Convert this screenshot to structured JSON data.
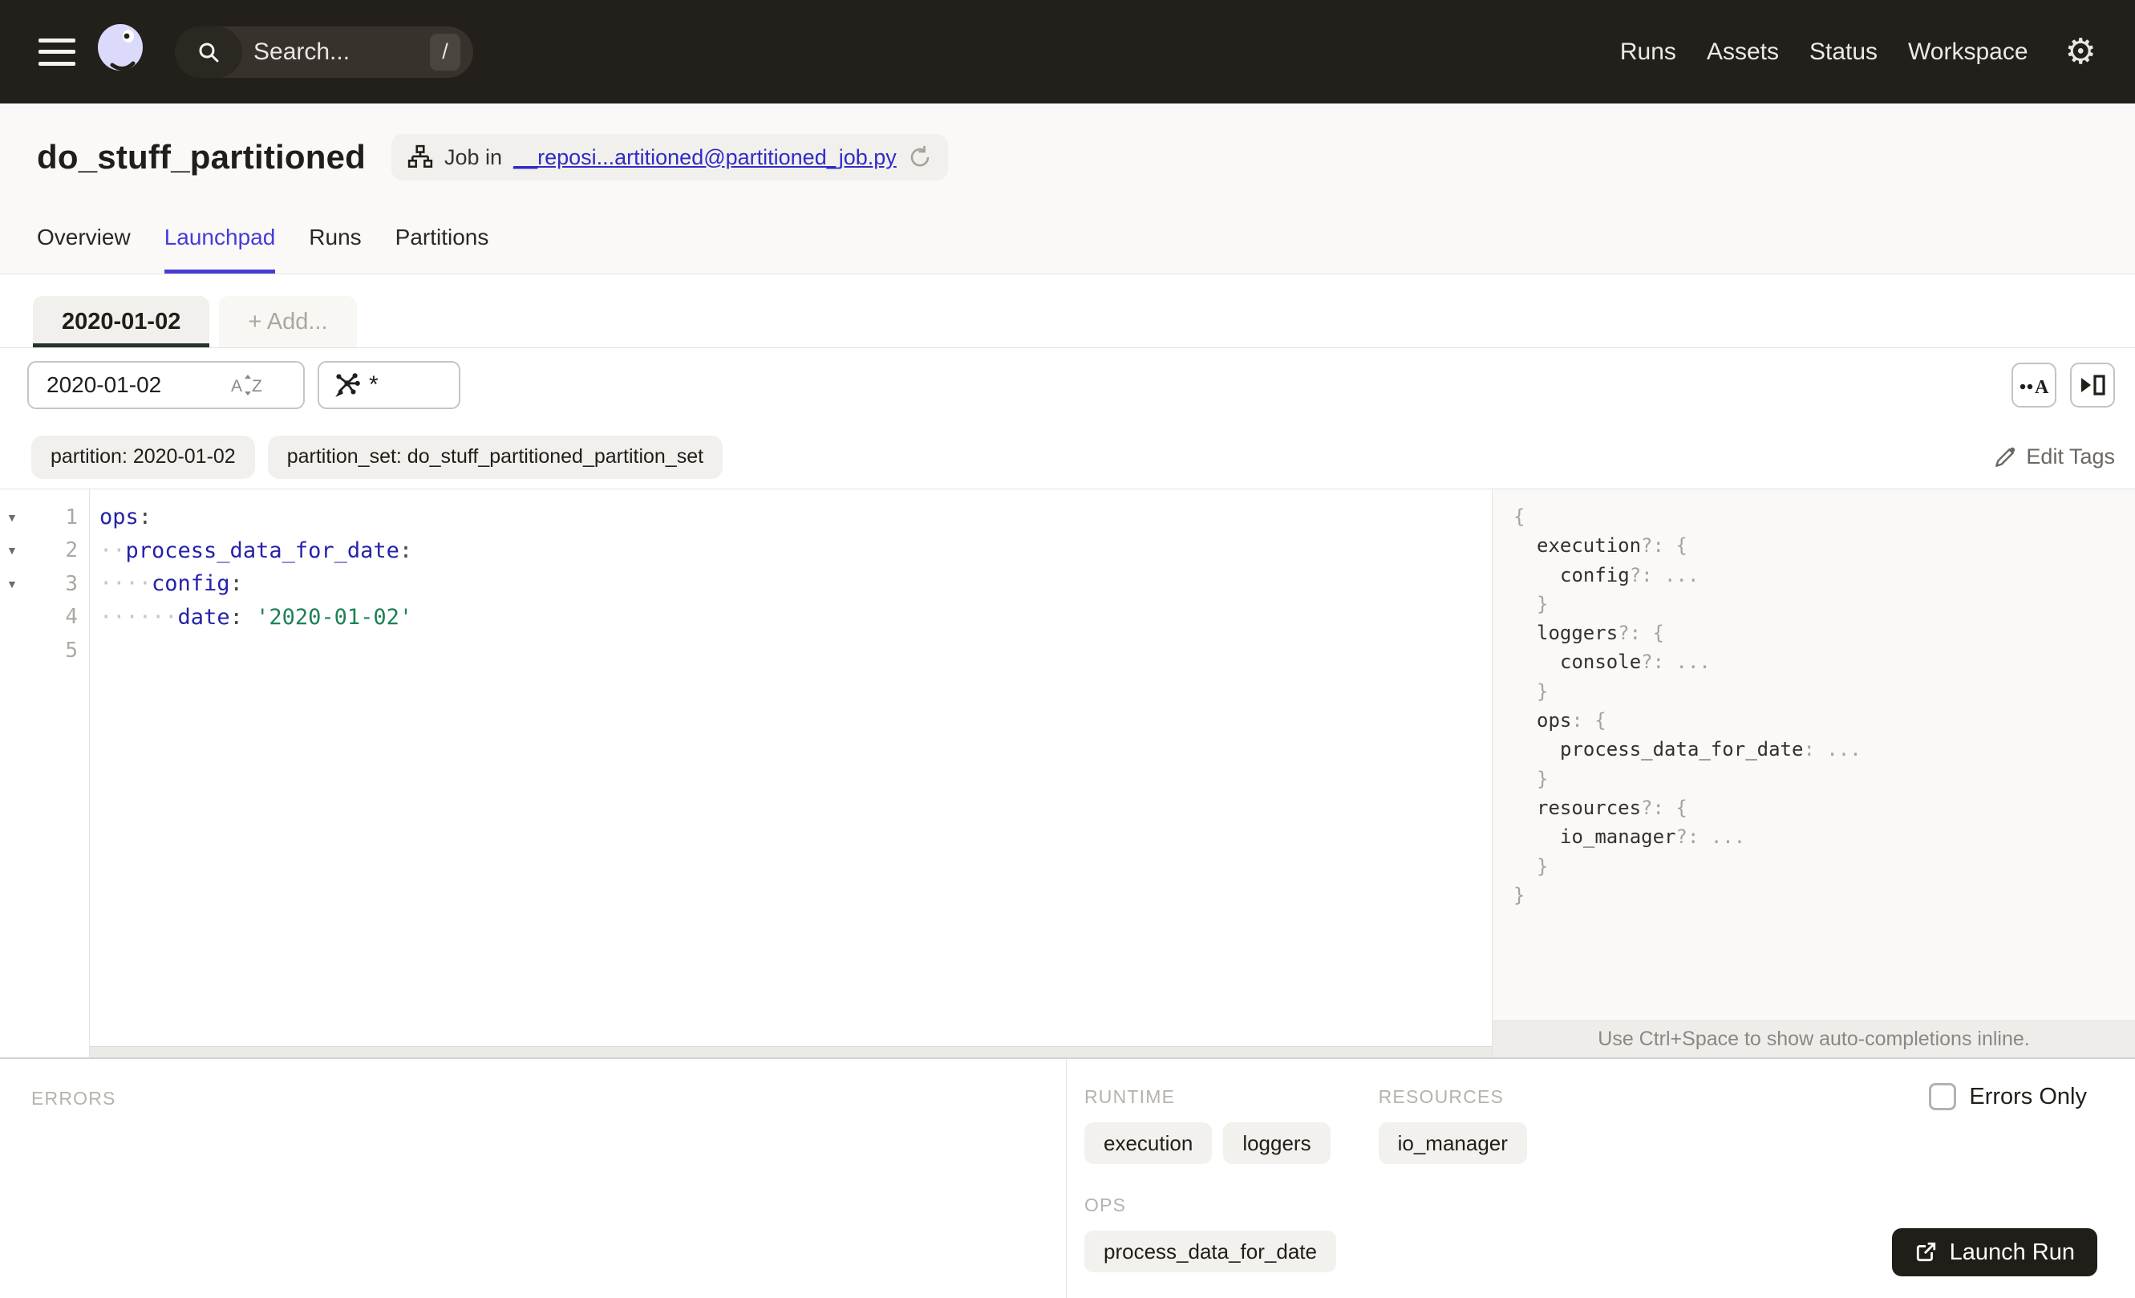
{
  "colors": {
    "nav_bg": "#231f1a",
    "accent_blue": "#453cd8",
    "link_blue": "#2f2bc7",
    "partition_tab_underline": "#213529",
    "yaml_key": "#2522a8",
    "yaml_string": "#1e8155",
    "launch_button_bg": "#211e1a"
  },
  "nav": {
    "search_placeholder": "Search...",
    "search_shortcut": "/",
    "links": [
      "Runs",
      "Assets",
      "Status",
      "Workspace"
    ]
  },
  "header": {
    "title": "do_stuff_partitioned",
    "badge": {
      "prefix": "Job in",
      "link": "__reposi...artitioned@partitioned_job.py"
    },
    "tabs": [
      {
        "label": "Overview",
        "active": false
      },
      {
        "label": "Launchpad",
        "active": true
      },
      {
        "label": "Runs",
        "active": false
      },
      {
        "label": "Partitions",
        "active": false
      }
    ]
  },
  "launchpad": {
    "partition_tab": "2020-01-02",
    "add_tab_label": "+ Add...",
    "partition_input_value": "2020-01-02",
    "op_selection_value": "*"
  },
  "tags": {
    "pills": [
      "partition: 2020-01-02",
      "partition_set: do_stuff_partitioned_partition_set"
    ],
    "edit_label": "Edit Tags"
  },
  "editor": {
    "lines": [
      {
        "num": 1,
        "fold": true,
        "segments": [
          {
            "type": "key",
            "text": "ops"
          },
          {
            "type": "punct",
            "text": ":"
          }
        ]
      },
      {
        "num": 2,
        "fold": true,
        "segments": [
          {
            "type": "ws",
            "text": "··"
          },
          {
            "type": "key",
            "text": "process_data_for_date"
          },
          {
            "type": "punct",
            "text": ":"
          }
        ]
      },
      {
        "num": 3,
        "fold": true,
        "segments": [
          {
            "type": "ws",
            "text": "····"
          },
          {
            "type": "key",
            "text": "config"
          },
          {
            "type": "punct",
            "text": ":"
          }
        ]
      },
      {
        "num": 4,
        "fold": false,
        "segments": [
          {
            "type": "ws",
            "text": "······"
          },
          {
            "type": "key",
            "text": "date"
          },
          {
            "type": "punct",
            "text": ":"
          },
          {
            "type": "plain",
            "text": " "
          },
          {
            "type": "string",
            "text": "'2020-01-02'"
          }
        ]
      },
      {
        "num": 5,
        "fold": false,
        "segments": []
      }
    ]
  },
  "schema": {
    "lines": [
      {
        "indent": 0,
        "segments": [
          {
            "type": "punct",
            "text": "{"
          }
        ]
      },
      {
        "indent": 1,
        "segments": [
          {
            "type": "key",
            "text": "execution"
          },
          {
            "type": "punct",
            "text": "?: {"
          }
        ]
      },
      {
        "indent": 2,
        "segments": [
          {
            "type": "key",
            "text": "config"
          },
          {
            "type": "punct",
            "text": "?: ..."
          }
        ]
      },
      {
        "indent": 1,
        "segments": [
          {
            "type": "punct",
            "text": "}"
          }
        ]
      },
      {
        "indent": 1,
        "segments": [
          {
            "type": "key",
            "text": "loggers"
          },
          {
            "type": "punct",
            "text": "?: {"
          }
        ]
      },
      {
        "indent": 2,
        "segments": [
          {
            "type": "key",
            "text": "console"
          },
          {
            "type": "punct",
            "text": "?: ..."
          }
        ]
      },
      {
        "indent": 1,
        "segments": [
          {
            "type": "punct",
            "text": "}"
          }
        ]
      },
      {
        "indent": 1,
        "segments": [
          {
            "type": "key",
            "text": "ops"
          },
          {
            "type": "punct",
            "text": ": {"
          }
        ]
      },
      {
        "indent": 2,
        "segments": [
          {
            "type": "key",
            "text": "process_data_for_date"
          },
          {
            "type": "punct",
            "text": ": ..."
          }
        ]
      },
      {
        "indent": 1,
        "segments": [
          {
            "type": "punct",
            "text": "}"
          }
        ]
      },
      {
        "indent": 1,
        "segments": [
          {
            "type": "key",
            "text": "resources"
          },
          {
            "type": "punct",
            "text": "?: {"
          }
        ]
      },
      {
        "indent": 2,
        "segments": [
          {
            "type": "key",
            "text": "io_manager"
          },
          {
            "type": "punct",
            "text": "?: ..."
          }
        ]
      },
      {
        "indent": 1,
        "segments": [
          {
            "type": "punct",
            "text": "}"
          }
        ]
      },
      {
        "indent": 0,
        "segments": [
          {
            "type": "punct",
            "text": "}"
          }
        ]
      }
    ],
    "hint": "Use Ctrl+Space to show auto-completions inline."
  },
  "bottom": {
    "errors_label": "ERRORS",
    "sections": [
      {
        "label": "RUNTIME",
        "pills": [
          "execution",
          "loggers"
        ]
      },
      {
        "label": "RESOURCES",
        "pills": [
          "io_manager"
        ]
      },
      {
        "label": "OPS",
        "pills": [
          "process_data_for_date"
        ]
      }
    ],
    "errors_only_label": "Errors Only",
    "launch_label": "Launch Run"
  }
}
